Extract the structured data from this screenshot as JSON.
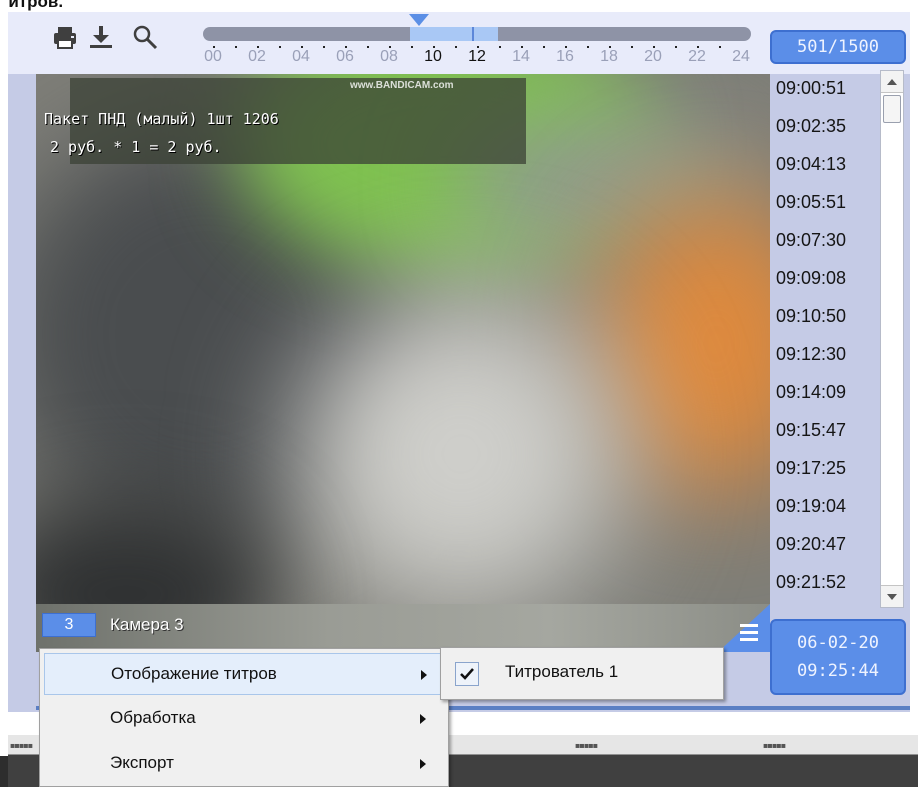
{
  "caption_fragment": "титров.",
  "toolbar": {
    "print_icon": "printer-icon",
    "download_icon": "download-icon",
    "search_icon": "magnifier-icon"
  },
  "timeline": {
    "hours": [
      "00",
      "02",
      "04",
      "06",
      "08",
      "10",
      "12",
      "14",
      "16",
      "18",
      "20",
      "22",
      "24"
    ],
    "active_hours": [
      "10",
      "12"
    ]
  },
  "counter": "501/1500",
  "video": {
    "watermark": "www.BANDICAM.com",
    "caption_line1": "Пакет ПНД (малый) 1шт 1206",
    "caption_line2": "2 руб. * 1 = 2 руб."
  },
  "time_list": [
    "09:00:51",
    "09:02:35",
    "09:04:13",
    "09:05:51",
    "09:07:30",
    "09:09:08",
    "09:10:50",
    "09:12:30",
    "09:14:09",
    "09:15:47",
    "09:17:25",
    "09:19:04",
    "09:20:47",
    "09:21:52"
  ],
  "camera": {
    "number": "3",
    "name": "Камера 3"
  },
  "datetime": {
    "date": "06-02-20",
    "time": "09:25:44"
  },
  "context_menu": {
    "items": [
      {
        "label": "Отображение титров",
        "has_submenu": true
      },
      {
        "label": "Обработка",
        "has_submenu": true
      },
      {
        "label": "Экспорт",
        "has_submenu": true
      }
    ]
  },
  "submenu": {
    "items": [
      {
        "label": "Титрователь 1",
        "checked": true
      }
    ]
  },
  "colors": {
    "accent": "#5b8ee8",
    "panel": "#c5cbe6",
    "menu_bg": "#f0f0f0"
  }
}
